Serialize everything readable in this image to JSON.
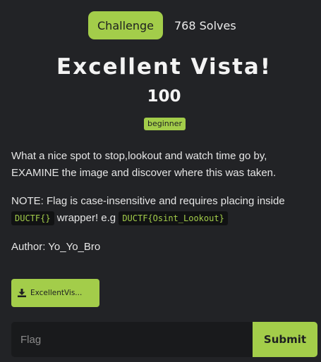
{
  "header": {
    "tab_label": "Challenge",
    "solves": "768 Solves"
  },
  "challenge": {
    "title": "Excellent Vista!",
    "points": "100",
    "difficulty": "beginner"
  },
  "description": {
    "line1": "What a nice spot to stop,lookout and watch time go by, EXAMINE the image and discover where this was taken.",
    "note_prefix": "NOTE: Flag is case-insensitive and requires placing inside",
    "wrapper_code": "DUCTF{}",
    "note_middle": "wrapper! e.g",
    "example_code": "DUCTF{Osint_Lookout}",
    "author": "Author: Yo_Yo_Bro"
  },
  "download": {
    "label": "ExcellentVis...",
    "icon": "download-icon"
  },
  "flag_form": {
    "placeholder": "Flag",
    "submit_label": "Submit"
  },
  "colors": {
    "background": "#222326",
    "accent": "#a3cd4a",
    "input_bg": "#191a1c",
    "code_bg": "#111213"
  }
}
